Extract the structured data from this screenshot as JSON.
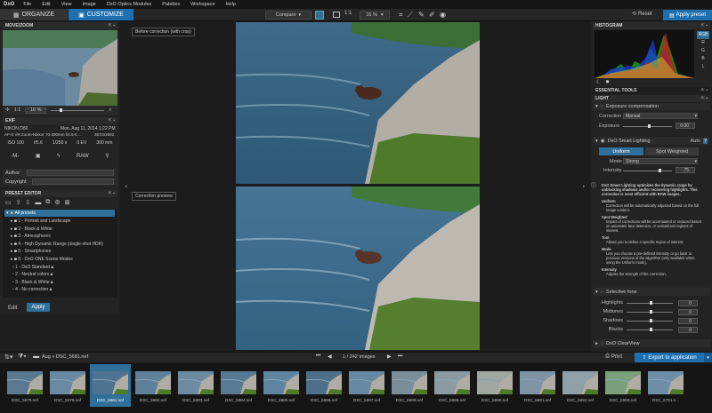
{
  "menu": {
    "logo": "DxO",
    "items": [
      "File",
      "Edit",
      "View",
      "Image",
      "DxO Optics Modules",
      "Palettes",
      "Workspace",
      "Help"
    ]
  },
  "toolbar": {
    "organize": "ORGANIZE",
    "customize": "CUSTOMIZE",
    "compare": "Compare",
    "ratio": "1:1",
    "zoom": "16 %",
    "reset": "Reset",
    "apply_preset": "Apply preset"
  },
  "move_zoom": {
    "title": "MOVE/ZOOM",
    "ratio": "1:1",
    "zoom": "16 %"
  },
  "exif": {
    "title": "EXIF",
    "camera": "NIKON D80",
    "date": "Mon, Aug 11, 2014 1:22 PM",
    "lens": "AF-S VR Zoom-Nikkor 70-300mm f/4.5-5....",
    "dims": "3872x2592",
    "iso": "ISO 100",
    "aperture": "f/5.6",
    "shutter": "1/250 s",
    "ev": "0 EV",
    "focal": "300 mm",
    "mode": "-M-",
    "raw": "RAW",
    "author_label": "Author",
    "copyright_label": "Copyright"
  },
  "preset_editor": {
    "title": "PRESET EDITOR",
    "root": "All presets",
    "items": [
      "1 - Portrait and Landscape",
      "2 - Black & White",
      "3 - Atmospheres",
      "4 - High Dynamic Range (single-shot HDR)",
      "5 - Smartphones",
      "6 - DxO ONE Scene Modes"
    ],
    "presets": [
      "1 - DxO Standard",
      "2 - Neutral colors",
      "3 - Black & White",
      "4 - No correction"
    ],
    "edit": "Edit",
    "apply": "Apply"
  },
  "viewer": {
    "before_label": "Before correction (with crop)",
    "preview_label": "Correction preview",
    "page": "1 / 242",
    "page_suffix": "images"
  },
  "histogram": {
    "title": "HISTOGRAM",
    "channels": [
      "RGB",
      "R",
      "G",
      "B",
      "L"
    ]
  },
  "tools": {
    "essential": "ESSENTIAL TOOLS",
    "light": "LIGHT",
    "exposure_title": "Exposure compensation",
    "correction_label": "Correction",
    "correction_value": "Manual",
    "exposure_label": "Exposure",
    "exposure_value": "0.00",
    "smart_title": "DxO Smart Lighting",
    "smart_auto": "Auto",
    "uniform": "Uniform",
    "spot": "Spot Weighted",
    "mode_label": "Mode",
    "mode_value": "Strong",
    "intensity_label": "Intensity",
    "intensity_value": "75",
    "help_text": "DxO Smart Lighting optimizes the dynamic range by unblocking shadows and/or recovering highlights. This correction is most efficient with RAW images.",
    "help_uniform_h": "Uniform",
    "help_uniform": "Correction will be automatically adjusted based on the full image content.",
    "help_spot_h": "Spot Weighted",
    "help_spot": "Impact of corrections will be accentuated or reduced based on automatic face detection, or customized regions of interest.",
    "help_tool_h": "Tool",
    "help_tool": "Allows you to define a specific region of interest.",
    "help_mode_h": "Mode",
    "help_mode": "Lets you choose a pre-defined intensity or go back to previous versions of the algorithm (only available when using the Uniform mode).",
    "help_int_h": "Intensity",
    "help_int": "Adjusts the strength of the correction.",
    "selective_title": "Selective tone",
    "tones": [
      {
        "label": "Highlights",
        "value": "0"
      },
      {
        "label": "Midtones",
        "value": "0"
      },
      {
        "label": "Shadows",
        "value": "0"
      },
      {
        "label": "Blacks",
        "value": "0"
      }
    ],
    "clearview": "DxO ClearView"
  },
  "browser": {
    "path": "Aug » DSC_5681.nef",
    "print": "Print",
    "export": "Export to application"
  },
  "filmstrip": [
    "DSC_5678.nef",
    "DSC_5679.nef",
    "DSC_5681.nef",
    "DSC_5682.nef",
    "DSC_5683.nef",
    "DSC_5684.nef",
    "DSC_5685.nef",
    "DSC_5686.nef",
    "DSC_5687.nef",
    "DSC_5688.nef",
    "DSC_5689.nef",
    "DSC_5690.nef",
    "DSC_5691.nef",
    "DSC_5692.nef",
    "DSC_5693.nef",
    "DSC_5701.n..."
  ],
  "colors": {
    "accent": "#1e6fb0",
    "selected": "#2f6f9a"
  }
}
